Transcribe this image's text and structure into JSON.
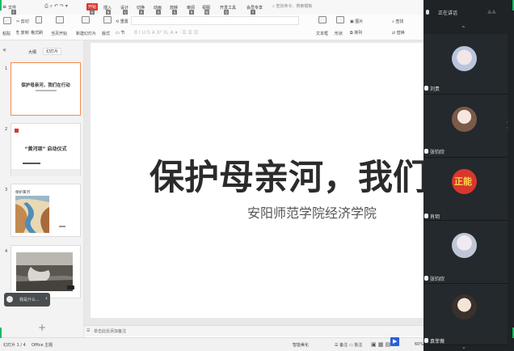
{
  "menu": {
    "items": [
      "文件",
      "开始",
      "插入",
      "设计",
      "切换",
      "动画",
      "放映",
      "审阅",
      "视图",
      "开发工具",
      "会员专享"
    ],
    "active_index": 1,
    "search": "查找命令、搜索模板",
    "key_tips": [
      "F",
      "H",
      "N",
      "G",
      "K",
      "A",
      "S",
      "R",
      "W",
      "D",
      "Y"
    ]
  },
  "ribbon": {
    "labels": [
      "剪切",
      "粘贴",
      "复制",
      "格式刷",
      "当页开始",
      "新建幻灯片",
      "版式",
      "重置",
      "节",
      "文本框",
      "形状",
      "图片",
      "排列",
      "查找",
      "替换"
    ]
  },
  "panel": {
    "tabs": [
      "大纲",
      "幻灯片"
    ],
    "thumbs": [
      {
        "num": "1",
        "title": "保护母亲河，我们在行动"
      },
      {
        "num": "2",
        "title": "“黄河颂” 启动仪式"
      },
      {
        "num": "3",
        "title": "保护黄河"
      },
      {
        "num": "4"
      }
    ],
    "add": "+",
    "overlay": "我是什么..."
  },
  "slide": {
    "title": "保护母亲河，我们在行",
    "subtitle": "安阳师范学院经济学院"
  },
  "notes": {
    "text": "单击此处添加备注"
  },
  "status": {
    "slide_index": "幻灯片 1 / 4",
    "theme": "Office 主题",
    "smart_beautify": "智能美化",
    "notes": "备注",
    "comment": "批注",
    "zoom": "60%"
  },
  "meeting": {
    "header": "正在讲话",
    "tiles": [
      {
        "name": "刘贵"
      },
      {
        "name": "张钧欣"
      },
      {
        "name": "肖玥"
      },
      {
        "name": "张钧欣"
      },
      {
        "name": "袁菲薇"
      }
    ],
    "badge": "正能"
  }
}
